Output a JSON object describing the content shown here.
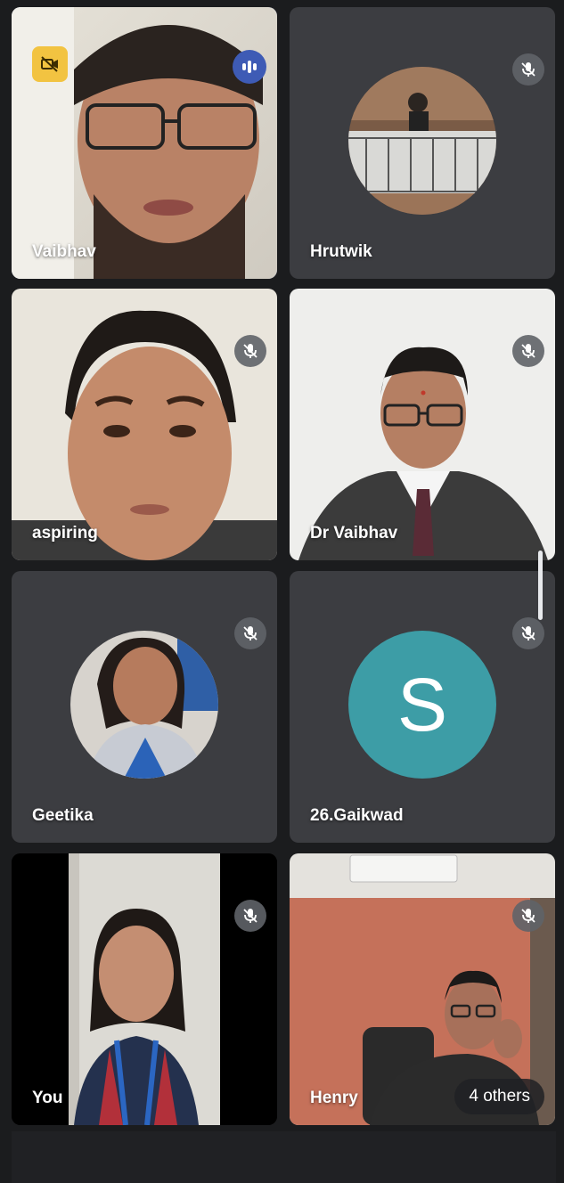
{
  "participants": [
    {
      "name": "Vaibhav",
      "mic": "speaking",
      "camera": "off-badge"
    },
    {
      "name": "Hrutwik",
      "mic": "muted"
    },
    {
      "name": "aspiring",
      "mic": "muted"
    },
    {
      "name": "Dr Vaibhav",
      "mic": "muted"
    },
    {
      "name": "Geetika",
      "mic": "muted"
    },
    {
      "name": "26.Gaikwad",
      "mic": "muted",
      "avatar_letter": "S",
      "avatar_color": "#3d9da6"
    },
    {
      "name": "You",
      "mic": "muted"
    },
    {
      "name": "Henry",
      "mic": "muted",
      "others_label": "4 others"
    }
  ],
  "colors": {
    "speaking_border": "#4b63b5",
    "tile_bg": "#3c3d41",
    "camera_off_badge": "#f2c341"
  },
  "icons": {
    "muted": "mic-off-icon",
    "speaking": "audio-level-icon",
    "camera_off": "video-off-icon"
  }
}
